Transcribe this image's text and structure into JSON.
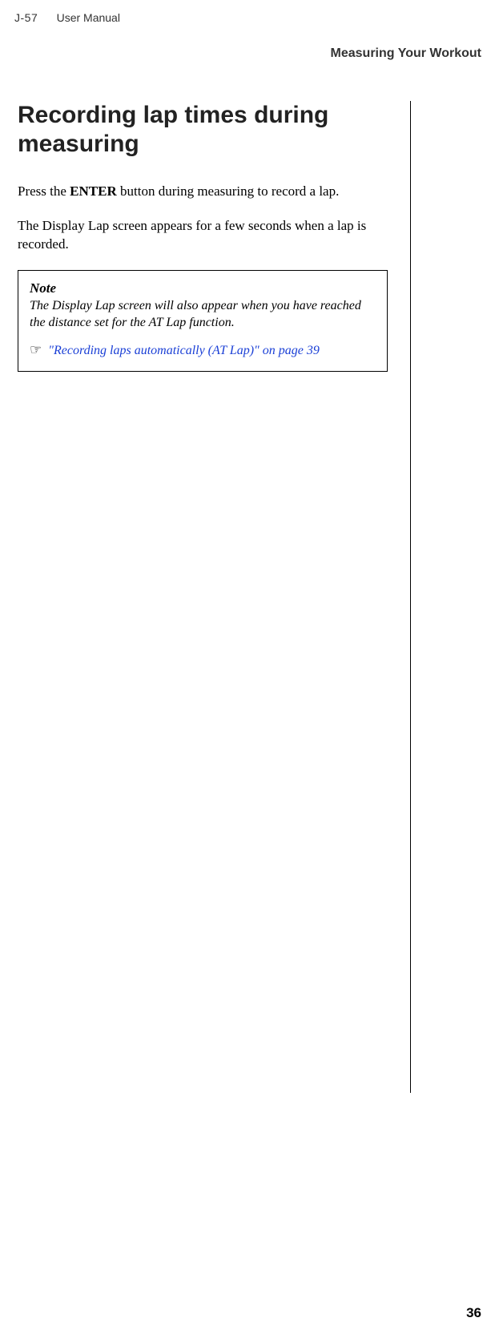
{
  "header": {
    "model": "J-57",
    "manual": "User Manual"
  },
  "section": "Measuring Your Workout",
  "title": "Recording lap times during measuring",
  "para1_pre": "Press the ",
  "para1_bold": "ENTER",
  "para1_post": " button during measuring to record a lap.",
  "para2": "The Display Lap screen appears for a few seconds when a lap is recorded.",
  "note": {
    "heading": "Note",
    "body": "The Display Lap screen will also appear when you have reached the distance set for the AT Lap function.",
    "link_text": "\"Recording laps automatically (AT Lap)\" on page 39"
  },
  "page_number": "36"
}
